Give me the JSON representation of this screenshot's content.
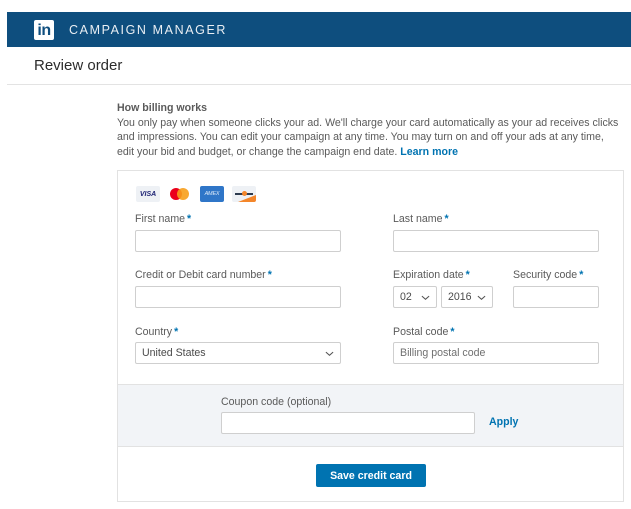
{
  "header": {
    "logo_text": "in",
    "app_title": "CAMPAIGN MANAGER"
  },
  "page": {
    "title": "Review order"
  },
  "billing_info": {
    "heading": "How billing works",
    "body": "You only pay when someone clicks your ad. We'll charge your card automatically as your ad receives clicks and impressions. You can edit your campaign at any time.  You  may turn on and off your ads at any time, edit your bid and budget, or change the campaign end date. ",
    "learn_more": "Learn more"
  },
  "card_brands": [
    {
      "name": "visa",
      "label": "VISA"
    },
    {
      "name": "mastercard",
      "label": ""
    },
    {
      "name": "amex",
      "label": "AMEX"
    },
    {
      "name": "discover",
      "label": ""
    }
  ],
  "form": {
    "required_marker": "*",
    "first_name": {
      "label": "First name",
      "value": ""
    },
    "last_name": {
      "label": "Last name",
      "value": ""
    },
    "card_number": {
      "label": "Credit or Debit card number",
      "value": ""
    },
    "expiration": {
      "label": "Expiration date",
      "month": "02",
      "year": "2016"
    },
    "security_code": {
      "label": "Security code",
      "value": ""
    },
    "country": {
      "label": "Country",
      "value": "United States"
    },
    "postal_code": {
      "label": "Postal code",
      "placeholder": "Billing postal code",
      "value": ""
    },
    "coupon": {
      "label": "Coupon code (optional)",
      "value": "",
      "apply_label": "Apply"
    },
    "save_label": "Save credit card"
  },
  "colors": {
    "header_bg": "#0e4e7e",
    "accent": "#0073b1",
    "coupon_band_bg": "#f2f4f7"
  }
}
